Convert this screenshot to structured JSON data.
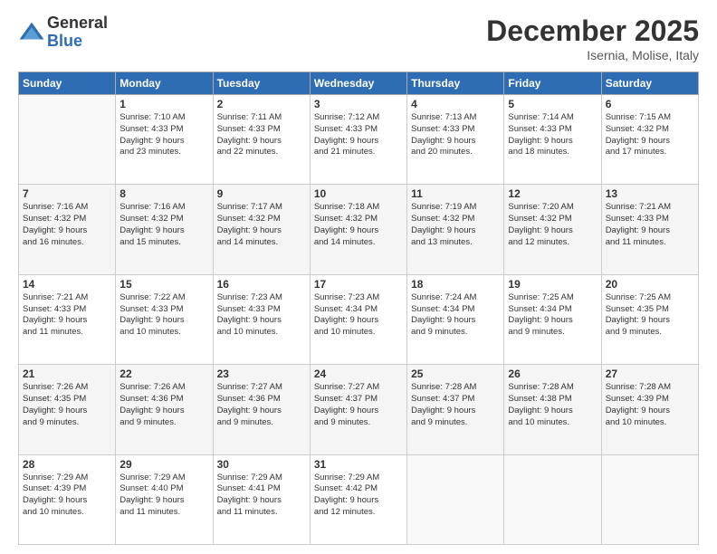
{
  "logo": {
    "general": "General",
    "blue": "Blue"
  },
  "header": {
    "month": "December 2025",
    "location": "Isernia, Molise, Italy"
  },
  "days_of_week": [
    "Sunday",
    "Monday",
    "Tuesday",
    "Wednesday",
    "Thursday",
    "Friday",
    "Saturday"
  ],
  "weeks": [
    [
      {
        "day": "",
        "info": ""
      },
      {
        "day": "1",
        "info": "Sunrise: 7:10 AM\nSunset: 4:33 PM\nDaylight: 9 hours\nand 23 minutes."
      },
      {
        "day": "2",
        "info": "Sunrise: 7:11 AM\nSunset: 4:33 PM\nDaylight: 9 hours\nand 22 minutes."
      },
      {
        "day": "3",
        "info": "Sunrise: 7:12 AM\nSunset: 4:33 PM\nDaylight: 9 hours\nand 21 minutes."
      },
      {
        "day": "4",
        "info": "Sunrise: 7:13 AM\nSunset: 4:33 PM\nDaylight: 9 hours\nand 20 minutes."
      },
      {
        "day": "5",
        "info": "Sunrise: 7:14 AM\nSunset: 4:33 PM\nDaylight: 9 hours\nand 18 minutes."
      },
      {
        "day": "6",
        "info": "Sunrise: 7:15 AM\nSunset: 4:32 PM\nDaylight: 9 hours\nand 17 minutes."
      }
    ],
    [
      {
        "day": "7",
        "info": "Sunrise: 7:16 AM\nSunset: 4:32 PM\nDaylight: 9 hours\nand 16 minutes."
      },
      {
        "day": "8",
        "info": "Sunrise: 7:16 AM\nSunset: 4:32 PM\nDaylight: 9 hours\nand 15 minutes."
      },
      {
        "day": "9",
        "info": "Sunrise: 7:17 AM\nSunset: 4:32 PM\nDaylight: 9 hours\nand 14 minutes."
      },
      {
        "day": "10",
        "info": "Sunrise: 7:18 AM\nSunset: 4:32 PM\nDaylight: 9 hours\nand 14 minutes."
      },
      {
        "day": "11",
        "info": "Sunrise: 7:19 AM\nSunset: 4:32 PM\nDaylight: 9 hours\nand 13 minutes."
      },
      {
        "day": "12",
        "info": "Sunrise: 7:20 AM\nSunset: 4:32 PM\nDaylight: 9 hours\nand 12 minutes."
      },
      {
        "day": "13",
        "info": "Sunrise: 7:21 AM\nSunset: 4:33 PM\nDaylight: 9 hours\nand 11 minutes."
      }
    ],
    [
      {
        "day": "14",
        "info": "Sunrise: 7:21 AM\nSunset: 4:33 PM\nDaylight: 9 hours\nand 11 minutes."
      },
      {
        "day": "15",
        "info": "Sunrise: 7:22 AM\nSunset: 4:33 PM\nDaylight: 9 hours\nand 10 minutes."
      },
      {
        "day": "16",
        "info": "Sunrise: 7:23 AM\nSunset: 4:33 PM\nDaylight: 9 hours\nand 10 minutes."
      },
      {
        "day": "17",
        "info": "Sunrise: 7:23 AM\nSunset: 4:34 PM\nDaylight: 9 hours\nand 10 minutes."
      },
      {
        "day": "18",
        "info": "Sunrise: 7:24 AM\nSunset: 4:34 PM\nDaylight: 9 hours\nand 9 minutes."
      },
      {
        "day": "19",
        "info": "Sunrise: 7:25 AM\nSunset: 4:34 PM\nDaylight: 9 hours\nand 9 minutes."
      },
      {
        "day": "20",
        "info": "Sunrise: 7:25 AM\nSunset: 4:35 PM\nDaylight: 9 hours\nand 9 minutes."
      }
    ],
    [
      {
        "day": "21",
        "info": "Sunrise: 7:26 AM\nSunset: 4:35 PM\nDaylight: 9 hours\nand 9 minutes."
      },
      {
        "day": "22",
        "info": "Sunrise: 7:26 AM\nSunset: 4:36 PM\nDaylight: 9 hours\nand 9 minutes."
      },
      {
        "day": "23",
        "info": "Sunrise: 7:27 AM\nSunset: 4:36 PM\nDaylight: 9 hours\nand 9 minutes."
      },
      {
        "day": "24",
        "info": "Sunrise: 7:27 AM\nSunset: 4:37 PM\nDaylight: 9 hours\nand 9 minutes."
      },
      {
        "day": "25",
        "info": "Sunrise: 7:28 AM\nSunset: 4:37 PM\nDaylight: 9 hours\nand 9 minutes."
      },
      {
        "day": "26",
        "info": "Sunrise: 7:28 AM\nSunset: 4:38 PM\nDaylight: 9 hours\nand 10 minutes."
      },
      {
        "day": "27",
        "info": "Sunrise: 7:28 AM\nSunset: 4:39 PM\nDaylight: 9 hours\nand 10 minutes."
      }
    ],
    [
      {
        "day": "28",
        "info": "Sunrise: 7:29 AM\nSunset: 4:39 PM\nDaylight: 9 hours\nand 10 minutes."
      },
      {
        "day": "29",
        "info": "Sunrise: 7:29 AM\nSunset: 4:40 PM\nDaylight: 9 hours\nand 11 minutes."
      },
      {
        "day": "30",
        "info": "Sunrise: 7:29 AM\nSunset: 4:41 PM\nDaylight: 9 hours\nand 11 minutes."
      },
      {
        "day": "31",
        "info": "Sunrise: 7:29 AM\nSunset: 4:42 PM\nDaylight: 9 hours\nand 12 minutes."
      },
      {
        "day": "",
        "info": ""
      },
      {
        "day": "",
        "info": ""
      },
      {
        "day": "",
        "info": ""
      }
    ]
  ]
}
